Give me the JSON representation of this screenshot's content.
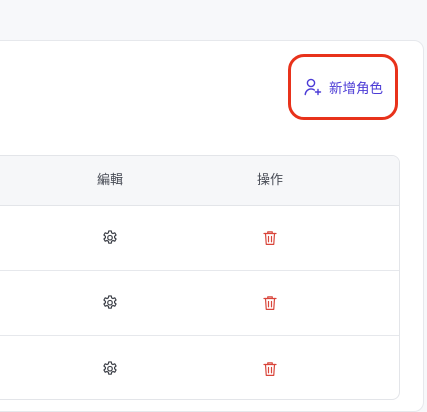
{
  "header": {
    "add_role_label": "新增角色"
  },
  "table": {
    "columns": [
      "編輯",
      "操作"
    ],
    "rows": [
      {
        "edit_icon": "gear-icon",
        "action_icon": "trash-icon"
      },
      {
        "edit_icon": "gear-icon",
        "action_icon": "trash-icon"
      },
      {
        "edit_icon": "gear-icon",
        "action_icon": "trash-icon"
      }
    ]
  },
  "colors": {
    "accent": "#4b3bd6",
    "highlight": "#e8321b",
    "danger": "#d9453a"
  }
}
